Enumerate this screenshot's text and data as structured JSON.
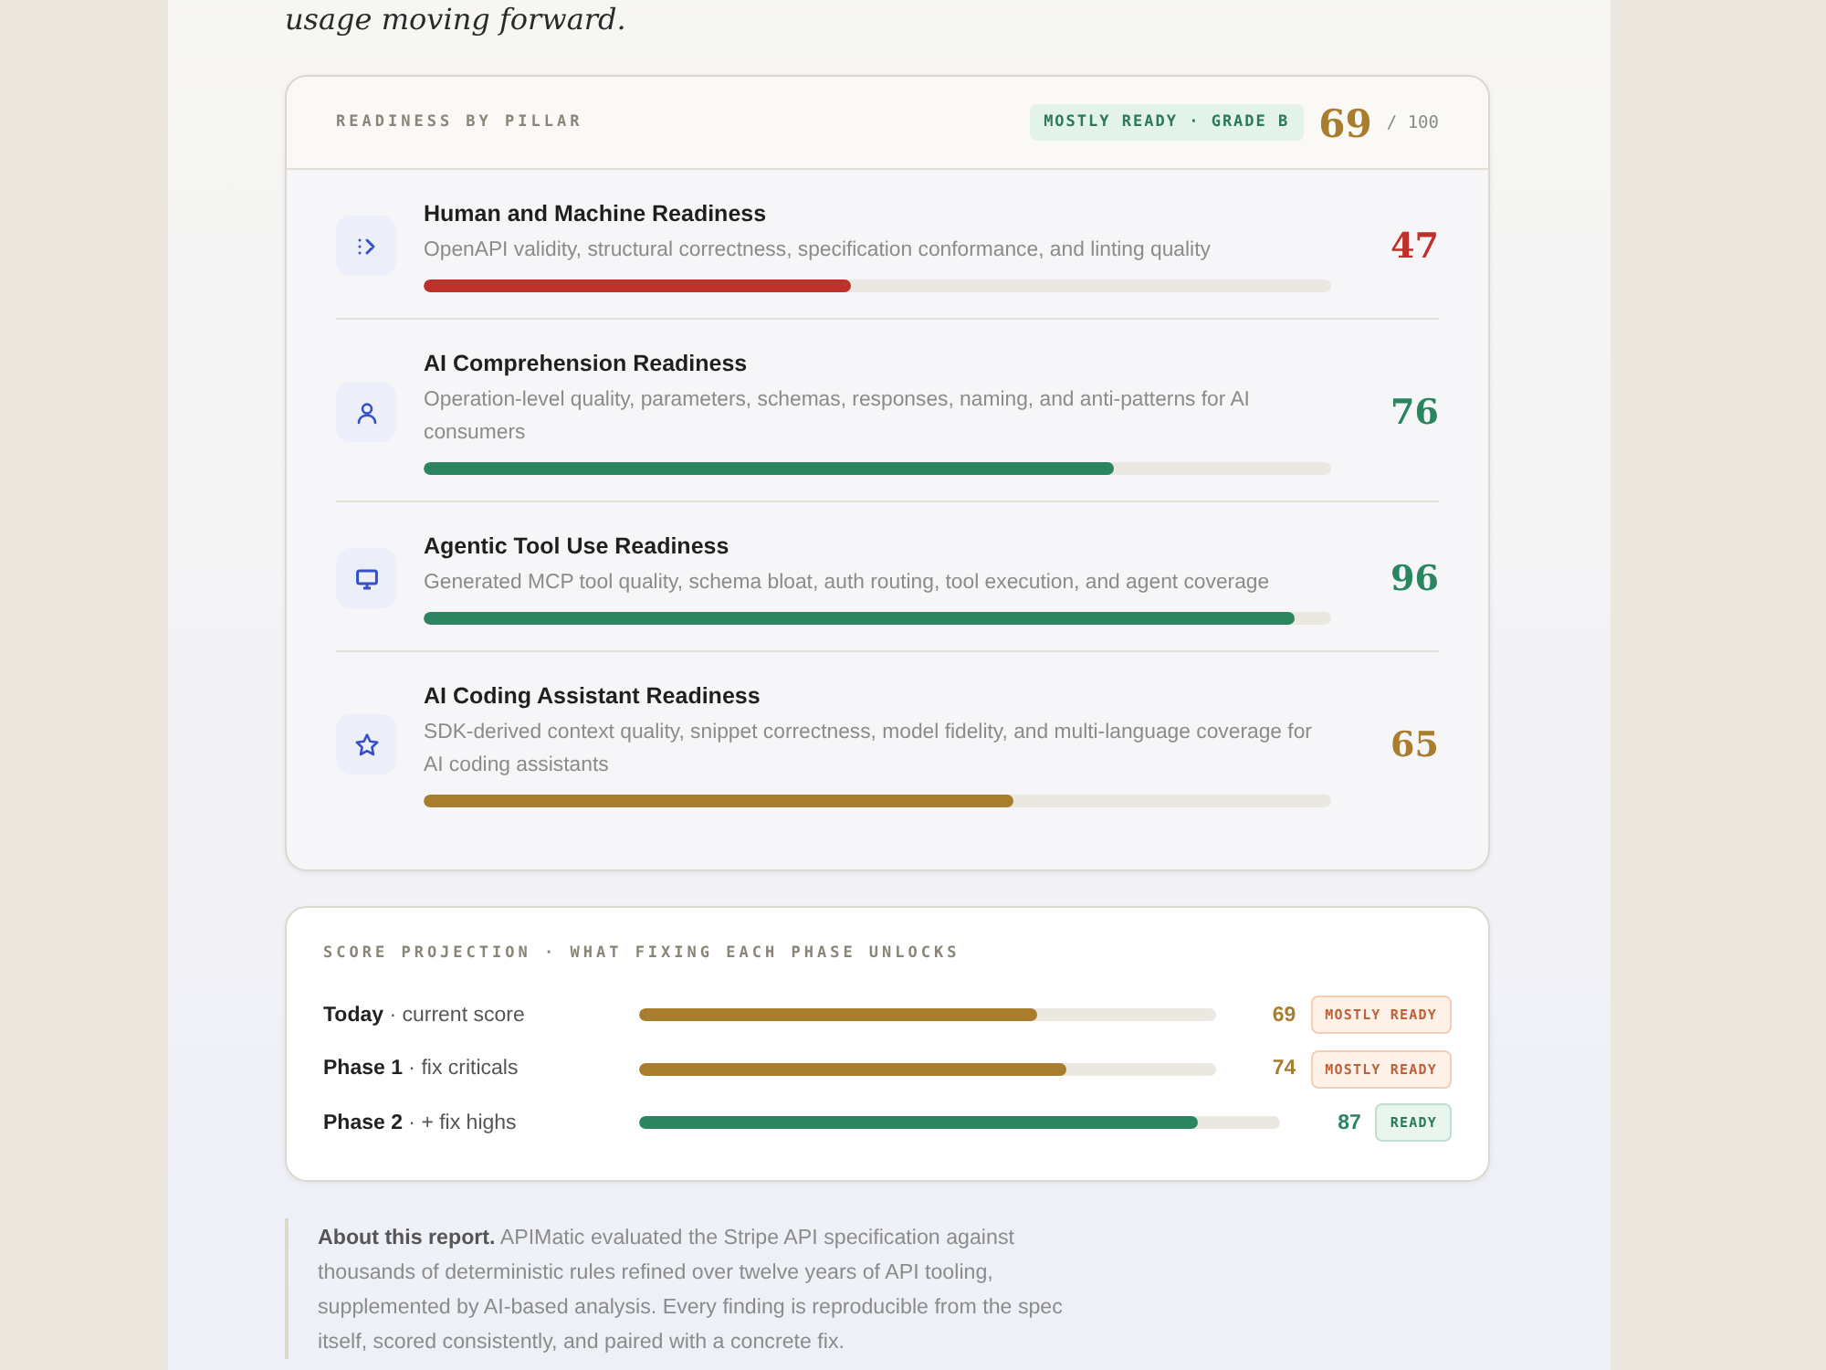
{
  "intro_tail": "usage moving forward.",
  "pillars_card": {
    "title": "READINESS BY PILLAR",
    "badge": "MOSTLY READY · GRADE B",
    "score": "69",
    "score_max": "/ 100",
    "pillars": [
      {
        "name": "Human and Machine Readiness",
        "description": "OpenAPI validity, structural correctness, specification conformance, and linting quality",
        "score": "47",
        "level": 0.47,
        "color": "#c0302b"
      },
      {
        "name": "AI Comprehension Readiness",
        "description": "Operation-level quality, parameters, schemas, responses, naming, and anti-patterns for AI consumers",
        "score": "76",
        "level": 0.76,
        "color": "#2a8560"
      },
      {
        "name": "Agentic Tool Use Readiness",
        "description": "Generated MCP tool quality, schema bloat, auth routing, tool execution, and agent coverage",
        "score": "96",
        "level": 0.96,
        "color": "#2a8560"
      },
      {
        "name": "AI Coding Assistant Readiness",
        "description": "SDK-derived context quality, snippet correctness, model fidelity, and multi-language coverage for AI coding assistants",
        "score": "65",
        "level": 0.65,
        "color": "#a87d2e"
      }
    ]
  },
  "projection_card": {
    "title": "SCORE PROJECTION · WHAT FIXING EACH PHASE UNLOCKS",
    "rows": [
      {
        "label": "**Today** · current score",
        "level": 0.69,
        "score": "69",
        "badge": "MOSTLY READY",
        "kind": "mostly"
      },
      {
        "label": "**Phase 1** · fix criticals",
        "level": 0.74,
        "score": "74",
        "badge": "MOSTLY READY",
        "kind": "mostly"
      },
      {
        "label": "**Phase 2** · + fix highs",
        "level": 0.87,
        "score": "87",
        "badge": "READY",
        "kind": "ready"
      }
    ]
  },
  "about": "**About this report.** APIMatic evaluated the Stripe API specification against thousands of deterministic rules refined over twelve years of API tooling, supplemented by AI-based analysis. Every finding is reproducible from the spec itself, scored consistently, and paired with a concrete fix."
}
